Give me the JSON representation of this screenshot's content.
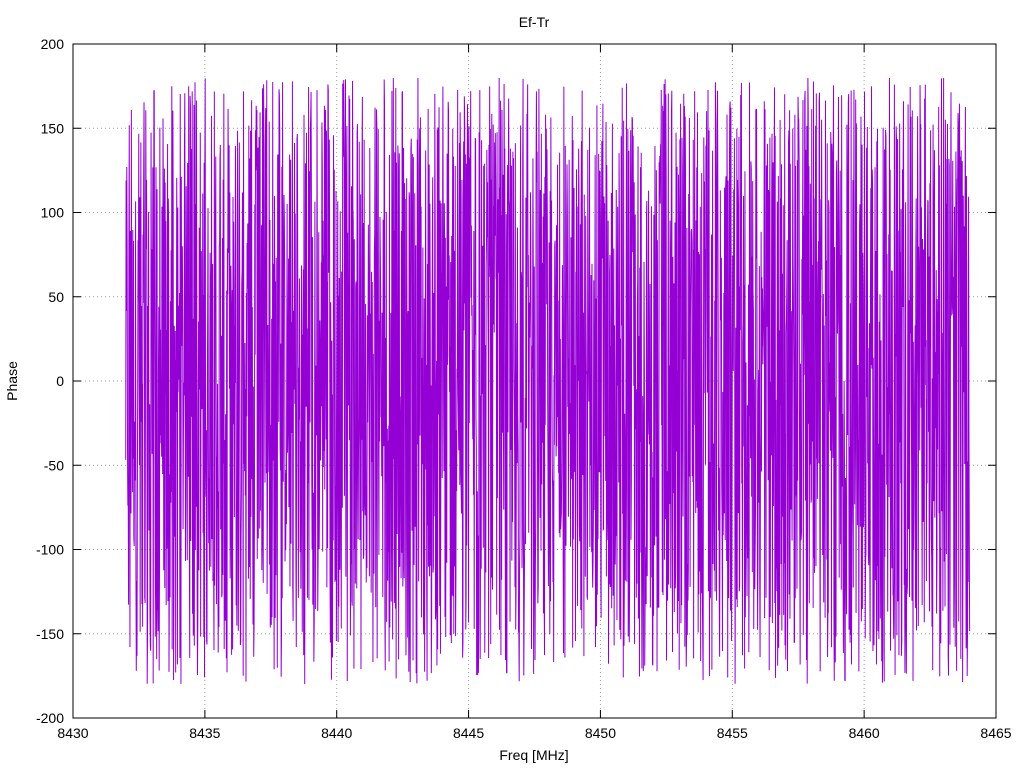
{
  "chart_data": {
    "type": "line",
    "title": "Ef-Tr",
    "xlabel": "Freq [MHz]",
    "ylabel": "Phase",
    "xlim": [
      8430,
      8465
    ],
    "ylim": [
      -200,
      200
    ],
    "xticks": [
      "8430",
      "8435",
      "8440",
      "8445",
      "8450",
      "8455",
      "8460",
      "8465"
    ],
    "yticks": [
      "200",
      "150",
      "100",
      "50",
      "0",
      "-50",
      "-100",
      "-150",
      "-200"
    ],
    "grid": true,
    "legend": "none",
    "series": [
      {
        "color": "#9400d3",
        "x_range": [
          8432,
          8464
        ],
        "pattern": "noise",
        "y_range": [
          -180,
          180
        ]
      }
    ]
  }
}
